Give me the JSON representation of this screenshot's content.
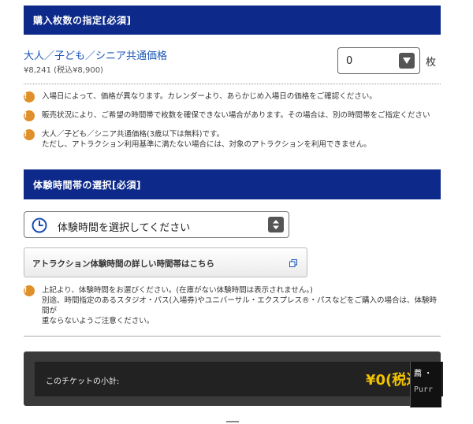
{
  "section1": {
    "title": "購入枚数の指定[必須]"
  },
  "ticket": {
    "name": "大人／子ども／シニア共通価格",
    "price": "¥8,241 (税込¥8,900)",
    "quantity": "0",
    "unit": "枚"
  },
  "notes1": [
    {
      "lines": [
        "入場日によって、価格が異なります。カレンダーより、あらかじめ入場日の価格をご確認ください。"
      ]
    },
    {
      "lines": [
        "販売状況により、ご希望の時間帯で枚数を確保できない場合があります。その場合は、別の時間帯をご指定ください"
      ]
    },
    {
      "lines": [
        "大人／子ども／シニア共通価格(3歳以下は無料)です。",
        "ただし、アトラクション利用基準に満たない場合には、対象のアトラクションを利用できません。"
      ]
    }
  ],
  "section2": {
    "title": "体験時間帯の選択[必須]"
  },
  "time_select": {
    "placeholder": "体験時間を選択してください"
  },
  "details_link": {
    "label": "アトラクション体験時間の詳しい時間帯はこちら"
  },
  "notes2": [
    {
      "lines": [
        "上記より、体験時間をお選びください。(在庫がない体験時間は表示されません。)",
        "別途、時間指定のあるスタジオ・パス(入場券)やユニバーサル・エクスプレス®・パスなどをご購入の場合は、体験時間が",
        "重ならないようご注意ください。"
      ]
    }
  ],
  "subtotal": {
    "label": "このチケットの小計:",
    "value": "¥0(税込)"
  },
  "overlay": {
    "line1": "薦 ・",
    "line2": "Purr"
  },
  "colors": {
    "section_bar": "#0d2a8a",
    "link_blue": "#1a56b8",
    "warning": "#e0902a",
    "price_gold": "#f2c200"
  }
}
